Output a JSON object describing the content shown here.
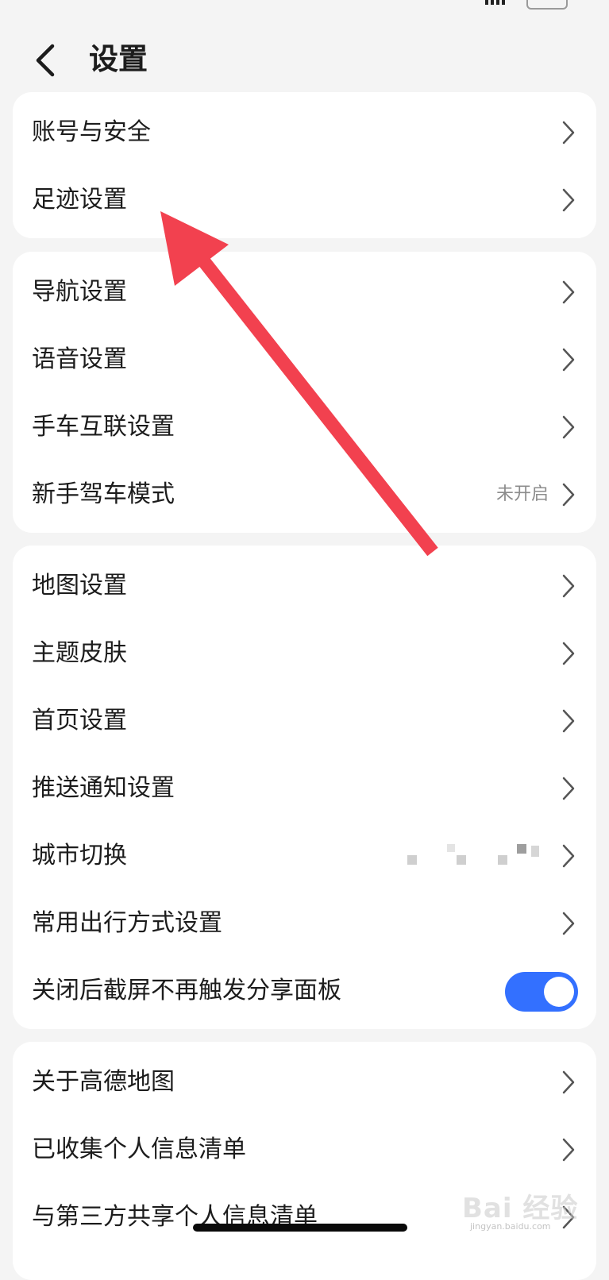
{
  "header": {
    "title": "设置"
  },
  "groups": [
    {
      "items": [
        {
          "label": "账号与安全"
        },
        {
          "label": "足迹设置"
        }
      ]
    },
    {
      "items": [
        {
          "label": "导航设置"
        },
        {
          "label": "语音设置"
        },
        {
          "label": "手车互联设置"
        },
        {
          "label": "新手驾车模式",
          "value": "未开启"
        }
      ]
    },
    {
      "items": [
        {
          "label": "地图设置"
        },
        {
          "label": "主题皮肤"
        },
        {
          "label": "首页设置"
        },
        {
          "label": "推送通知设置"
        },
        {
          "label": "城市切换"
        },
        {
          "label": "常用出行方式设置"
        },
        {
          "label": "关闭后截屏不再触发分享面板",
          "toggle": true
        }
      ]
    },
    {
      "items": [
        {
          "label": "关于高德地图"
        },
        {
          "label": "已收集个人信息清单"
        },
        {
          "label": "与第三方共享个人信息清单"
        }
      ]
    }
  ],
  "colors": {
    "background": "#f4f4f4",
    "card": "#ffffff",
    "toggle_on": "#3370ff",
    "annotation_arrow": "#f2414f"
  },
  "icons": {
    "back": "chevron-left-icon",
    "row": "chevron-right-icon"
  },
  "watermark": {
    "brand": "Bai 经验",
    "url": "jingyan.baidu.com"
  }
}
